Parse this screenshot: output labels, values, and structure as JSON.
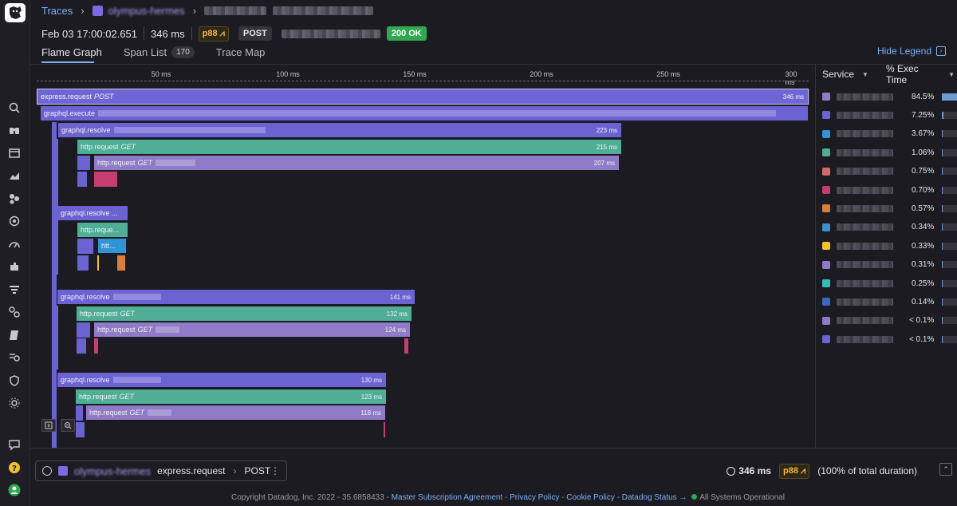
{
  "breadcrumb": {
    "root": "Traces",
    "service": "olympus-hermes"
  },
  "trace_meta": {
    "timestamp": "Feb 03 17:00:02.651",
    "duration": "346 ms",
    "percentile": "p88",
    "method": "POST",
    "status": "200 OK"
  },
  "tabs": {
    "flame": "Flame Graph",
    "spanlist": "Span List",
    "spanlist_count": "170",
    "tracemap": "Trace Map"
  },
  "hide_legend": "Hide Legend",
  "axis": {
    "ticks": [
      "50 ms",
      "100 ms",
      "150 ms",
      "200 ms",
      "250 ms",
      "300 ms"
    ]
  },
  "spans": {
    "s1": {
      "name": "express.request",
      "extra": "POST",
      "dur": "346 ms"
    },
    "s2": {
      "name": "graphql.execute"
    },
    "s3": {
      "name": "graphql.resolve",
      "dur": "223 ms"
    },
    "s4": {
      "name": "http.request",
      "extra": "GET",
      "dur": "215 ms"
    },
    "s5": {
      "name": "http.request",
      "extra": "GET",
      "dur": "207 ms"
    },
    "s6": {
      "name": "graphql.resolve ..."
    },
    "s7": {
      "name": "http.reque..."
    },
    "s8": {
      "name": "htt..."
    },
    "s9": {
      "name": "graphql.resolve",
      "dur": "141 ms"
    },
    "s10": {
      "name": "http.request",
      "extra": "GET",
      "dur": "132 ms"
    },
    "s11": {
      "name": "http.request",
      "extra": "GET",
      "dur": "124 ms"
    },
    "s12": {
      "name": "graphql.resolve",
      "dur": "130 ms"
    },
    "s13": {
      "name": "http.request",
      "extra": "GET",
      "dur": "123 ms"
    },
    "s14": {
      "name": "http.request",
      "extra": "GET",
      "dur": "118 ms"
    }
  },
  "legend": {
    "col_service": "Service",
    "col_exec": "% Exec Time",
    "rows": [
      {
        "color": "#8f7bc7",
        "pct": "84.5%",
        "fill": 0.845
      },
      {
        "color": "#6c63d3",
        "pct": "7.25%",
        "fill": 0.0725
      },
      {
        "color": "#2f95d6",
        "pct": "3.67%",
        "fill": 0.0367
      },
      {
        "color": "#4fae95",
        "pct": "1.06%",
        "fill": 0.0106
      },
      {
        "color": "#d36a6a",
        "pct": "0.75%",
        "fill": 0.0075
      },
      {
        "color": "#c63d73",
        "pct": "0.70%",
        "fill": 0.007
      },
      {
        "color": "#d97f3c",
        "pct": "0.57%",
        "fill": 0.0057
      },
      {
        "color": "#3f8fc9",
        "pct": "0.34%",
        "fill": 0.0034
      },
      {
        "color": "#f2c12e",
        "pct": "0.33%",
        "fill": 0.0033
      },
      {
        "color": "#8f7bc7",
        "pct": "0.31%",
        "fill": 0.0031
      },
      {
        "color": "#33bdb8",
        "pct": "0.25%",
        "fill": 0.0025
      },
      {
        "color": "#3d66c4",
        "pct": "0.14%",
        "fill": 0.0014
      },
      {
        "color": "#8f7bc7",
        "pct": "< 0.1%",
        "fill": 0.0
      },
      {
        "color": "#6c63d3",
        "pct": "< 0.1%",
        "fill": 0.0
      }
    ]
  },
  "footer": {
    "span_service": "olympus-hermes",
    "span_name": "express.request",
    "span_resource": "POST",
    "duration": "346 ms",
    "percentile": "p88",
    "share": "(100% of total duration)",
    "copyright": "Copyright Datadog, Inc. 2022 - 35.6858433 -",
    "link_msa": "Master Subscription Agreement",
    "link_privacy": "Privacy Policy",
    "link_cookie": "Cookie Policy",
    "link_status": "Datadog Status →",
    "all_ok": "All Systems Operational"
  }
}
